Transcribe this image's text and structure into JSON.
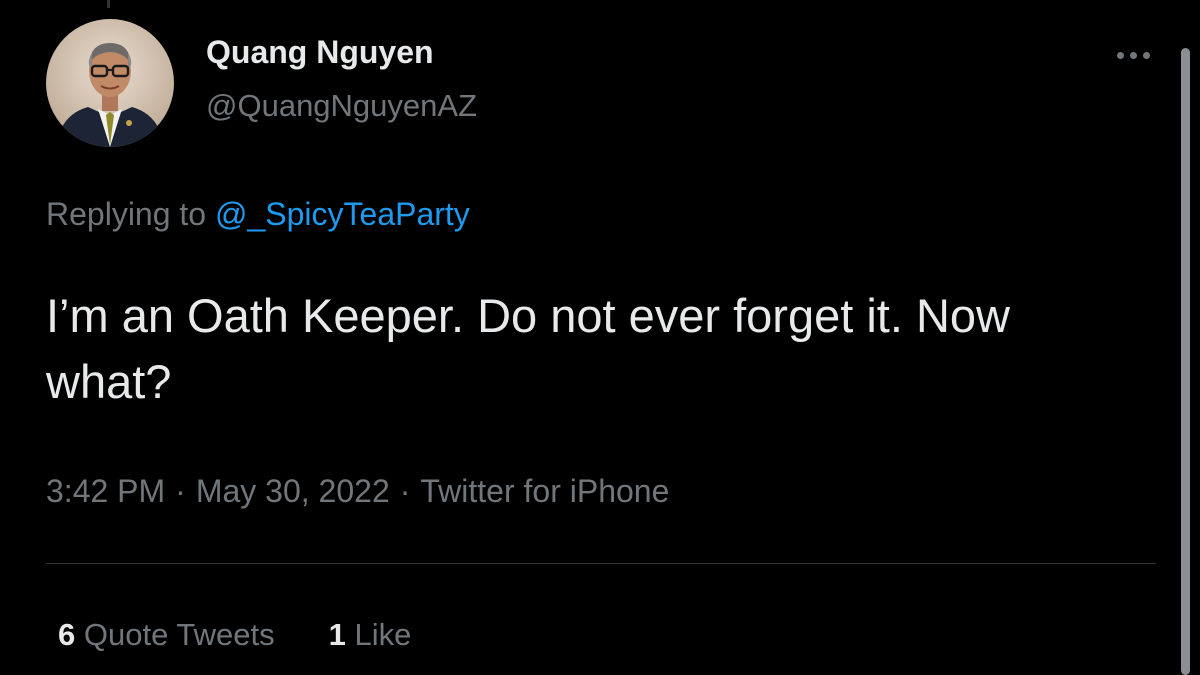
{
  "author": {
    "display_name": "Quang Nguyen",
    "handle": "@QuangNguyenAZ"
  },
  "reply": {
    "prefix": "Replying to ",
    "mention": "@_SpicyTeaParty"
  },
  "tweet": {
    "text": "I’m an Oath Keeper. Do not ever forget it. Now what?"
  },
  "meta": {
    "time": "3:42 PM",
    "separator": "·",
    "date": "May 30, 2022",
    "source": "Twitter for iPhone"
  },
  "stats": {
    "quote_tweets": {
      "count": "6",
      "label": "Quote Tweets"
    },
    "likes": {
      "count": "1",
      "label": "Like"
    }
  },
  "icons": {
    "more": "more-horizontal-icon"
  },
  "colors": {
    "background": "#000000",
    "text_primary": "#e7e9ea",
    "text_secondary": "#71767b",
    "accent": "#1d9bf0",
    "divider": "#2f3336"
  }
}
